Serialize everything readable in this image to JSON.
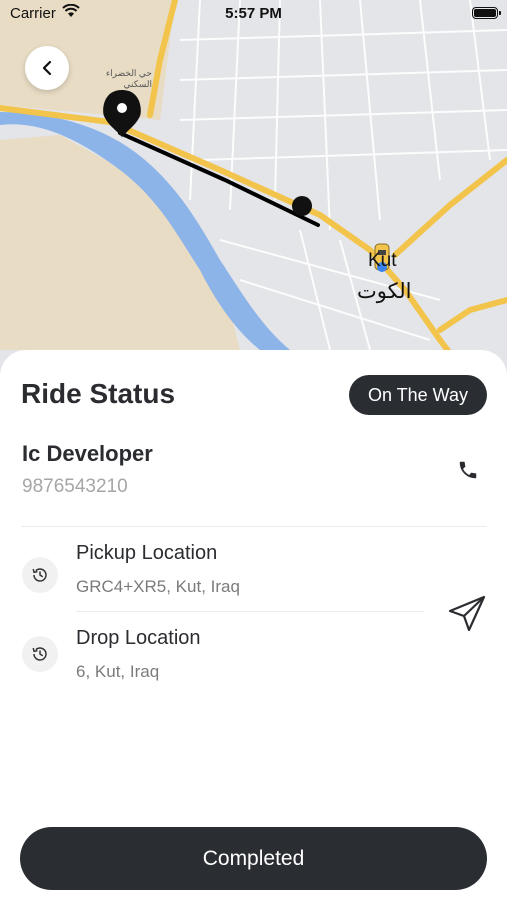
{
  "status_bar": {
    "carrier": "Carrier",
    "time": "5:57 PM"
  },
  "map": {
    "labels": {
      "city_en": "Kut",
      "city_ar": "الكوت",
      "district": "حي الخضراء السكني"
    }
  },
  "sheet": {
    "title": "Ride Status",
    "status_badge": "On The Way",
    "driver": {
      "name": "Ic Developer",
      "phone": "9876543210"
    },
    "pickup": {
      "label": "Pickup Location",
      "address": "GRC4+XR5, Kut, Iraq"
    },
    "drop": {
      "label": "Drop Location",
      "address": "6, Kut, Iraq"
    },
    "cta_label": "Completed"
  },
  "colors": {
    "dark": "#2a2e33",
    "road": "#f3c44b",
    "river": "#8cb4e8",
    "land": "#e8dcc4"
  }
}
